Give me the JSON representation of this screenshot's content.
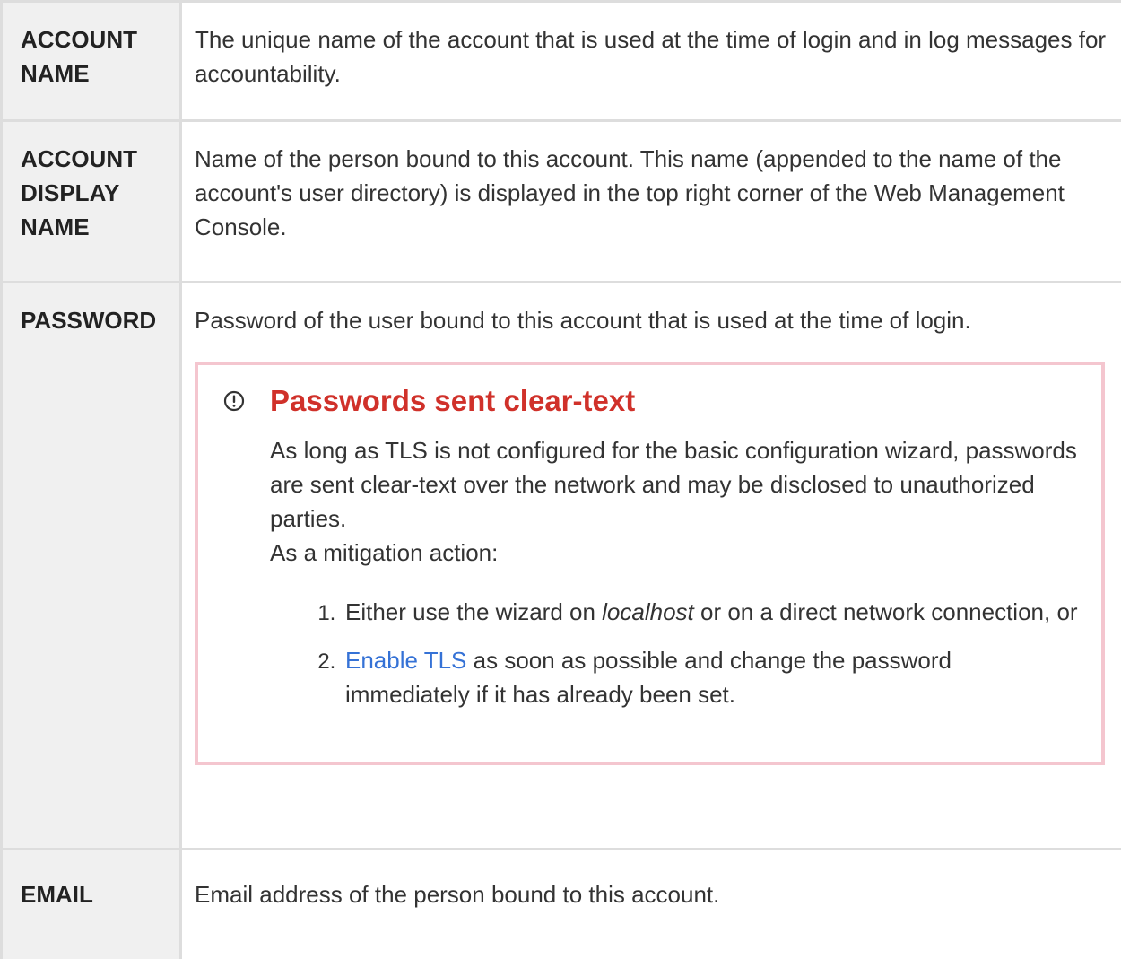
{
  "rows": [
    {
      "label_lines": [
        "ACCOUNT",
        "NAME"
      ],
      "description": "The unique name of the account that is used at the time of login and in log messages for accountability."
    },
    {
      "label_lines": [
        "ACCOUNT",
        "DISPLAY",
        "NAME"
      ],
      "description": "Name of the person bound to this account. This name (appended to the name of the account's user directory) is displayed in the top right corner of the Web Management Console."
    },
    {
      "label_lines": [
        "PASSWORD"
      ],
      "description": "Password of the user bound to this account that is used at the time of login."
    },
    {
      "label_lines": [
        "EMAIL"
      ],
      "description": "Email address of the person bound to this account."
    }
  ],
  "warning": {
    "icon": "exclamation-circle-icon",
    "title": "Passwords sent clear-text",
    "paragraph": "As long as TLS is not configured for the basic configuration wizard, passwords are sent clear-text over the network and may be disclosed to unauthorized parties.",
    "mitigation_intro": "As a mitigation action:",
    "steps": [
      {
        "before": "Either use the wizard on ",
        "emphasis": "localhost",
        "after": " or on a direct network connection, or"
      },
      {
        "link_text": "Enable TLS",
        "after": " as soon as possible and change the password immediately if it has already been set."
      }
    ]
  },
  "colors": {
    "label_background": "#f0f0f0",
    "border": "#dddddd",
    "warning_border": "#f4c6cf",
    "warning_title": "#d0312a",
    "link": "#3572d6"
  }
}
